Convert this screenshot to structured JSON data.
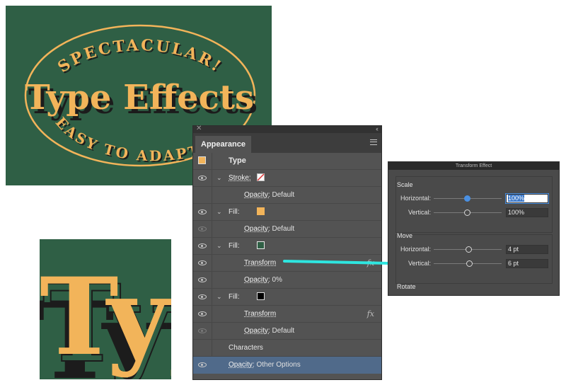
{
  "artwork_main": {
    "top_text": "SPECTACULAR!",
    "title": "Type Effects",
    "bottom_text": "EASY TO ADAPT",
    "colors": {
      "background": "#2f5f45",
      "fill": "#f2b45a",
      "shadow": "#1c1c1c"
    }
  },
  "artwork_zoom": {
    "text": "Type"
  },
  "appearance_panel": {
    "tab": "Appearance",
    "rows": [
      {
        "kind": "header",
        "label": "Type",
        "swatch": "#f2b45a"
      },
      {
        "kind": "stroke",
        "label": "Stroke:",
        "swatch": "stroke-none"
      },
      {
        "kind": "opacity",
        "label": "Opacity:",
        "value": "Default"
      },
      {
        "kind": "fill",
        "label": "Fill:",
        "swatch": "#f2b45a"
      },
      {
        "kind": "opacity",
        "label": "Opacity:",
        "value": "Default"
      },
      {
        "kind": "fill",
        "label": "Fill:",
        "swatch": "#2f5f45"
      },
      {
        "kind": "effect",
        "label": "Transform"
      },
      {
        "kind": "opacity",
        "label": "Opacity:",
        "value": "0%"
      },
      {
        "kind": "fill",
        "label": "Fill:",
        "swatch": "#000000"
      },
      {
        "kind": "effect",
        "label": "Transform"
      },
      {
        "kind": "opacity",
        "label": "Opacity:",
        "value": "Default"
      },
      {
        "kind": "characters",
        "label": "Characters"
      },
      {
        "kind": "opacity",
        "label": "Opacity:",
        "value": "Other Options"
      }
    ],
    "fx_label": "fx"
  },
  "transform_effect": {
    "title": "Transform Effect",
    "scale": {
      "heading": "Scale",
      "horizontal_label": "Horizontal:",
      "horizontal_value": "100%",
      "vertical_label": "Vertical:",
      "vertical_value": "100%"
    },
    "move": {
      "heading": "Move",
      "horizontal_label": "Horizontal:",
      "horizontal_value": "4 pt",
      "vertical_label": "Vertical:",
      "vertical_value": "6 pt"
    },
    "rotate": {
      "heading": "Rotate"
    }
  },
  "accent_color": "#2ee6e0"
}
